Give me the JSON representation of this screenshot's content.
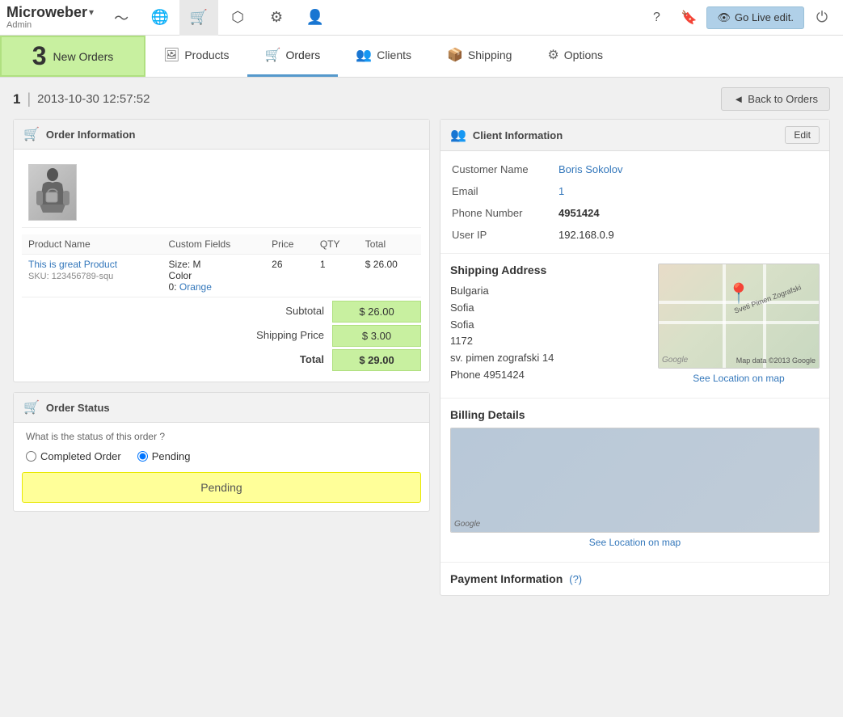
{
  "app": {
    "logo": "Microweber",
    "logo_sub": "Admin",
    "logo_arrow": "▾"
  },
  "top_nav": {
    "icons": [
      {
        "name": "analytics-icon",
        "symbol": "〜"
      },
      {
        "name": "globe-icon",
        "symbol": "⊕"
      },
      {
        "name": "cart-icon",
        "symbol": "🛒"
      },
      {
        "name": "workflow-icon",
        "symbol": "⬡"
      },
      {
        "name": "settings-icon",
        "symbol": "⚙"
      },
      {
        "name": "users-icon",
        "symbol": "👤"
      }
    ],
    "right_icons": [
      {
        "name": "help-icon",
        "symbol": "?"
      },
      {
        "name": "bookmark-icon",
        "symbol": "🔖"
      }
    ],
    "go_live_label": "Go Live edit.",
    "go_live_icon": "👁",
    "power_icon": "⏻"
  },
  "sub_nav": {
    "badge_number": "3",
    "badge_label": "New Orders",
    "tabs": [
      {
        "label": "Products",
        "icon": "🖼",
        "name": "tab-products",
        "active": false
      },
      {
        "label": "Orders",
        "icon": "🛒",
        "name": "tab-orders",
        "active": true
      },
      {
        "label": "Clients",
        "icon": "👥",
        "name": "tab-clients",
        "active": false
      },
      {
        "label": "Shipping",
        "icon": "📦",
        "name": "tab-shipping",
        "active": false
      },
      {
        "label": "Options",
        "icon": "⚙",
        "name": "tab-options",
        "active": false
      }
    ]
  },
  "order": {
    "id": "1",
    "separator": "|",
    "date": "2013-10-30 12:57:52",
    "back_button": "Back to Orders",
    "back_icon": "◄"
  },
  "order_info": {
    "panel_title": "Order Information",
    "panel_icon": "🛒",
    "table_headers": [
      "Product Name",
      "Custom Fields",
      "Price",
      "QTY",
      "Total"
    ],
    "products": [
      {
        "name": "This is great Product",
        "sku": "SKU: 123456789-squ",
        "custom_fields": "Size: M\nColor\n0: Orange",
        "size": "Size: M",
        "color_label": "Color",
        "color_val": "0: Orange",
        "price": "26",
        "qty": "1",
        "total": "$ 26.00"
      }
    ],
    "subtotal_label": "Subtotal",
    "subtotal_value": "$ 26.00",
    "shipping_label": "Shipping Price",
    "shipping_value": "$ 3.00",
    "total_label": "Total",
    "total_value": "$ 29.00"
  },
  "order_status": {
    "panel_title": "Order Status",
    "panel_icon": "🛒",
    "question": "What is the status of this order ?",
    "option_completed": "Completed Order",
    "option_pending": "Pending",
    "pending_selected": true,
    "status_button_label": "Pending"
  },
  "client_info": {
    "panel_title": "Client Information",
    "edit_label": "Edit",
    "customer_name_label": "Customer Name",
    "customer_name_value": "Boris Sokolov",
    "email_label": "Email",
    "email_value": "1",
    "phone_label": "Phone Number",
    "phone_value": "4951424",
    "ip_label": "User IP",
    "ip_value": "192.168.0.9"
  },
  "shipping": {
    "title": "Shipping Address",
    "country": "Bulgaria",
    "city1": "Sofia",
    "city2": "Sofia",
    "postal": "1172",
    "street": "sv. pimen zografski 14",
    "phone_label": "Phone",
    "phone_value": "4951424",
    "map_label": "Map data ©2013 Google",
    "map_street_label": "Sveti Pimen Zografski",
    "see_location": "See Location on map"
  },
  "billing": {
    "title": "Billing Details",
    "see_location": "See Location on map"
  },
  "payment": {
    "title": "Payment Information",
    "question": "(?)"
  }
}
